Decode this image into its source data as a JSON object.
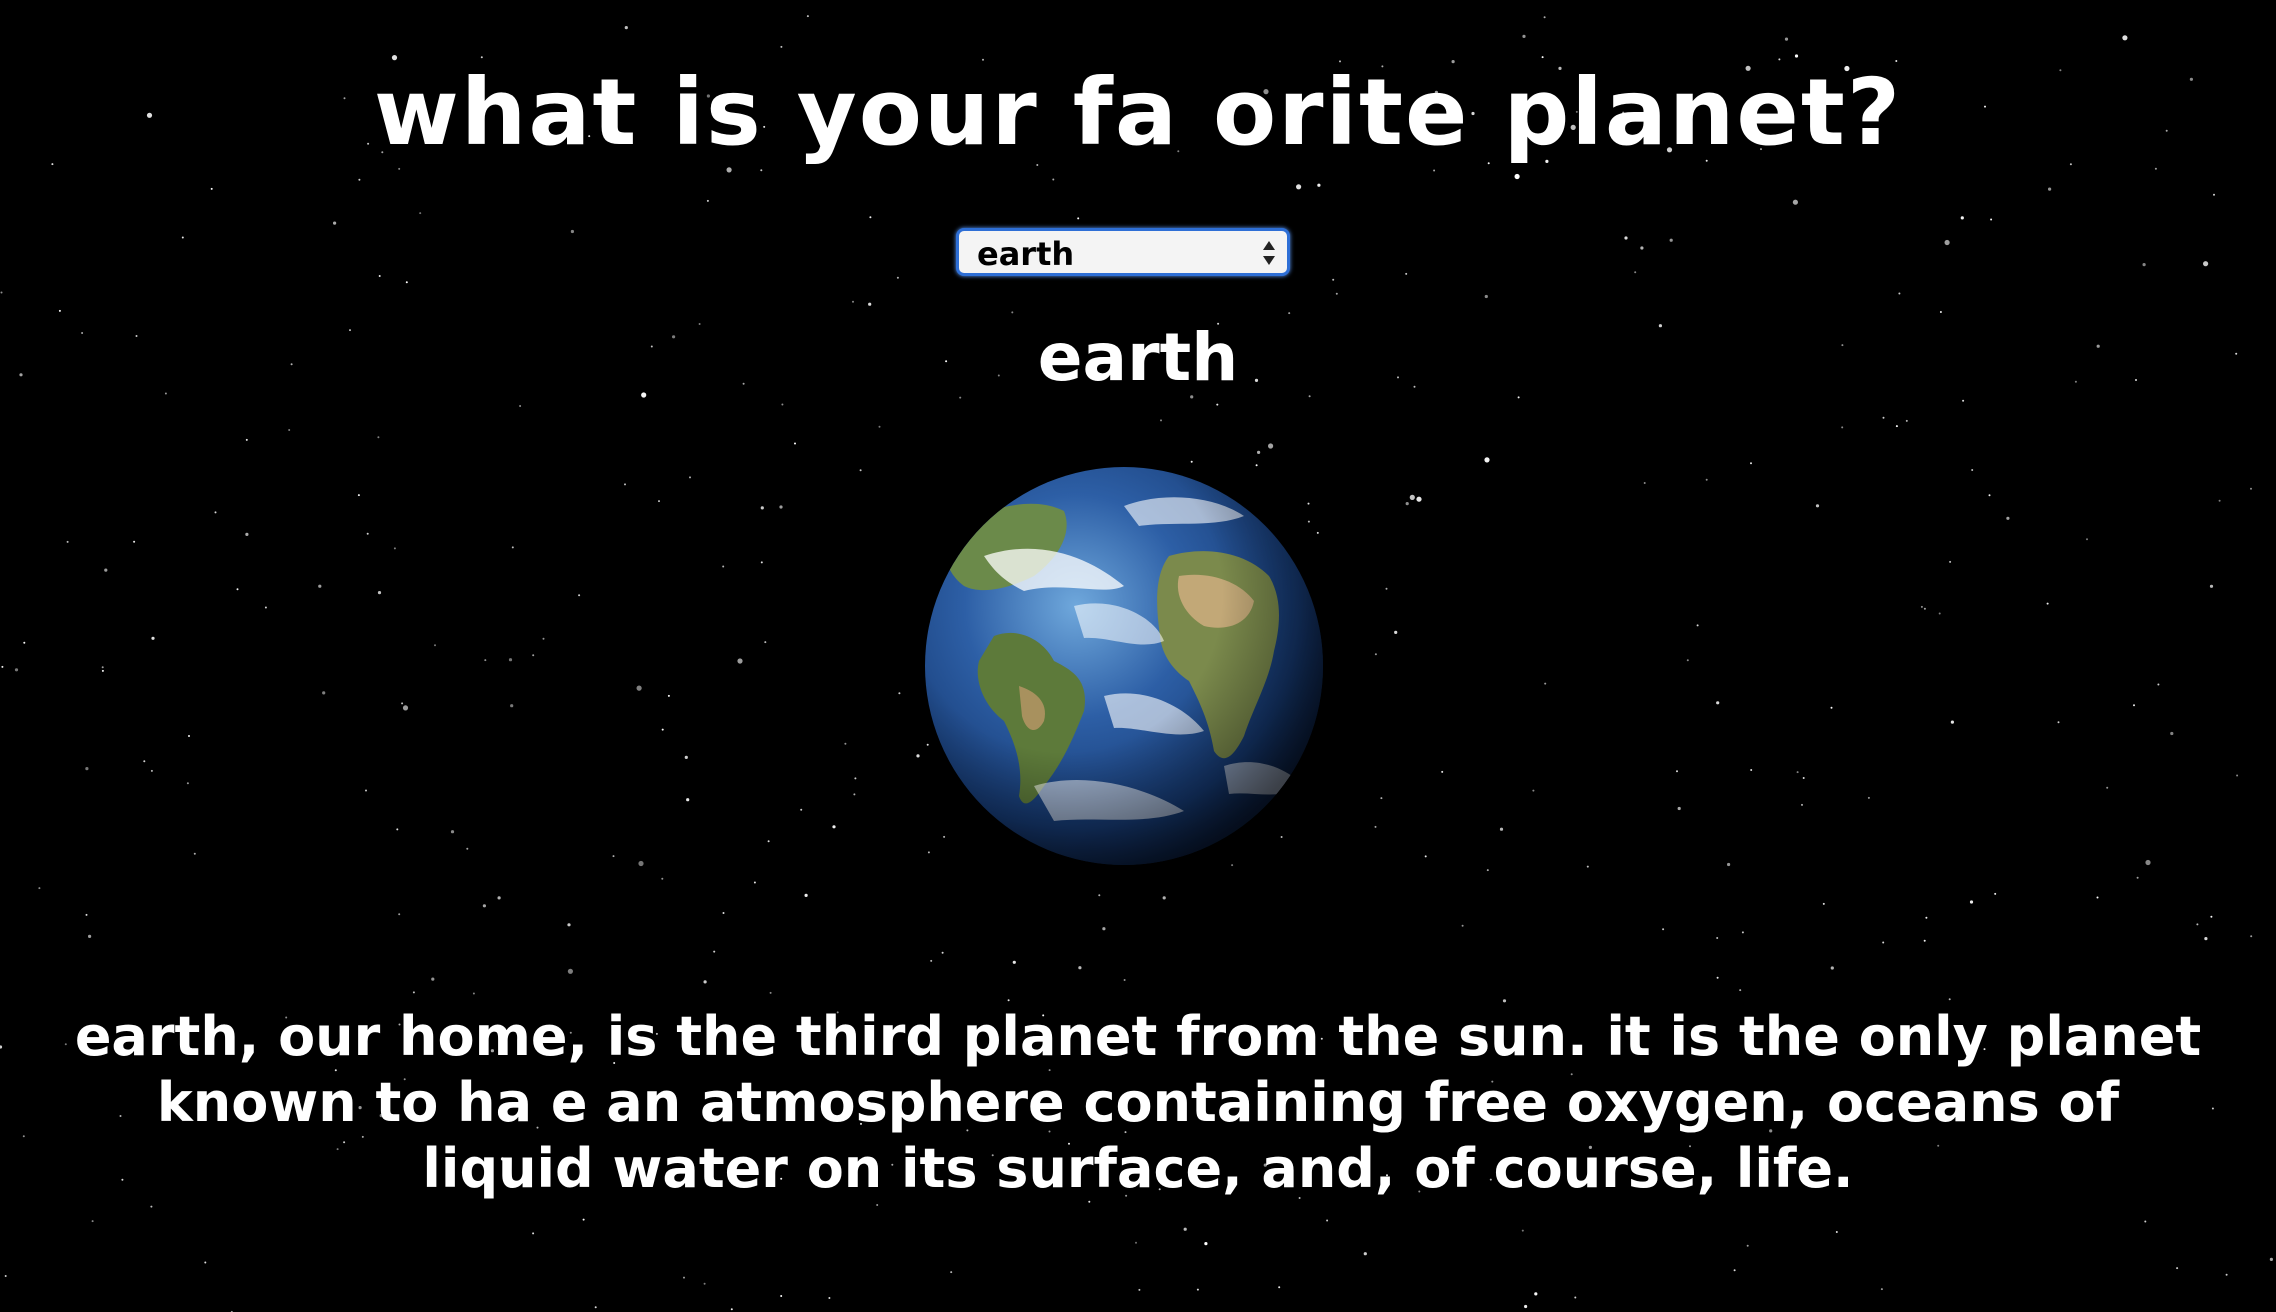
{
  "page": {
    "title": "what is your fa  orite planet?",
    "background_color": "#000000"
  },
  "planet_select": {
    "selected_value": "earth",
    "border_color": "#2e6fd6"
  },
  "planet": {
    "name": "earth",
    "image_icon": "earth-globe-icon",
    "description": "earth, our home, is the third planet from the sun. it is the only planet known to ha  e an atmosphere containing free oxygen, oceans of liquid water on its surface, and, of course, life."
  }
}
